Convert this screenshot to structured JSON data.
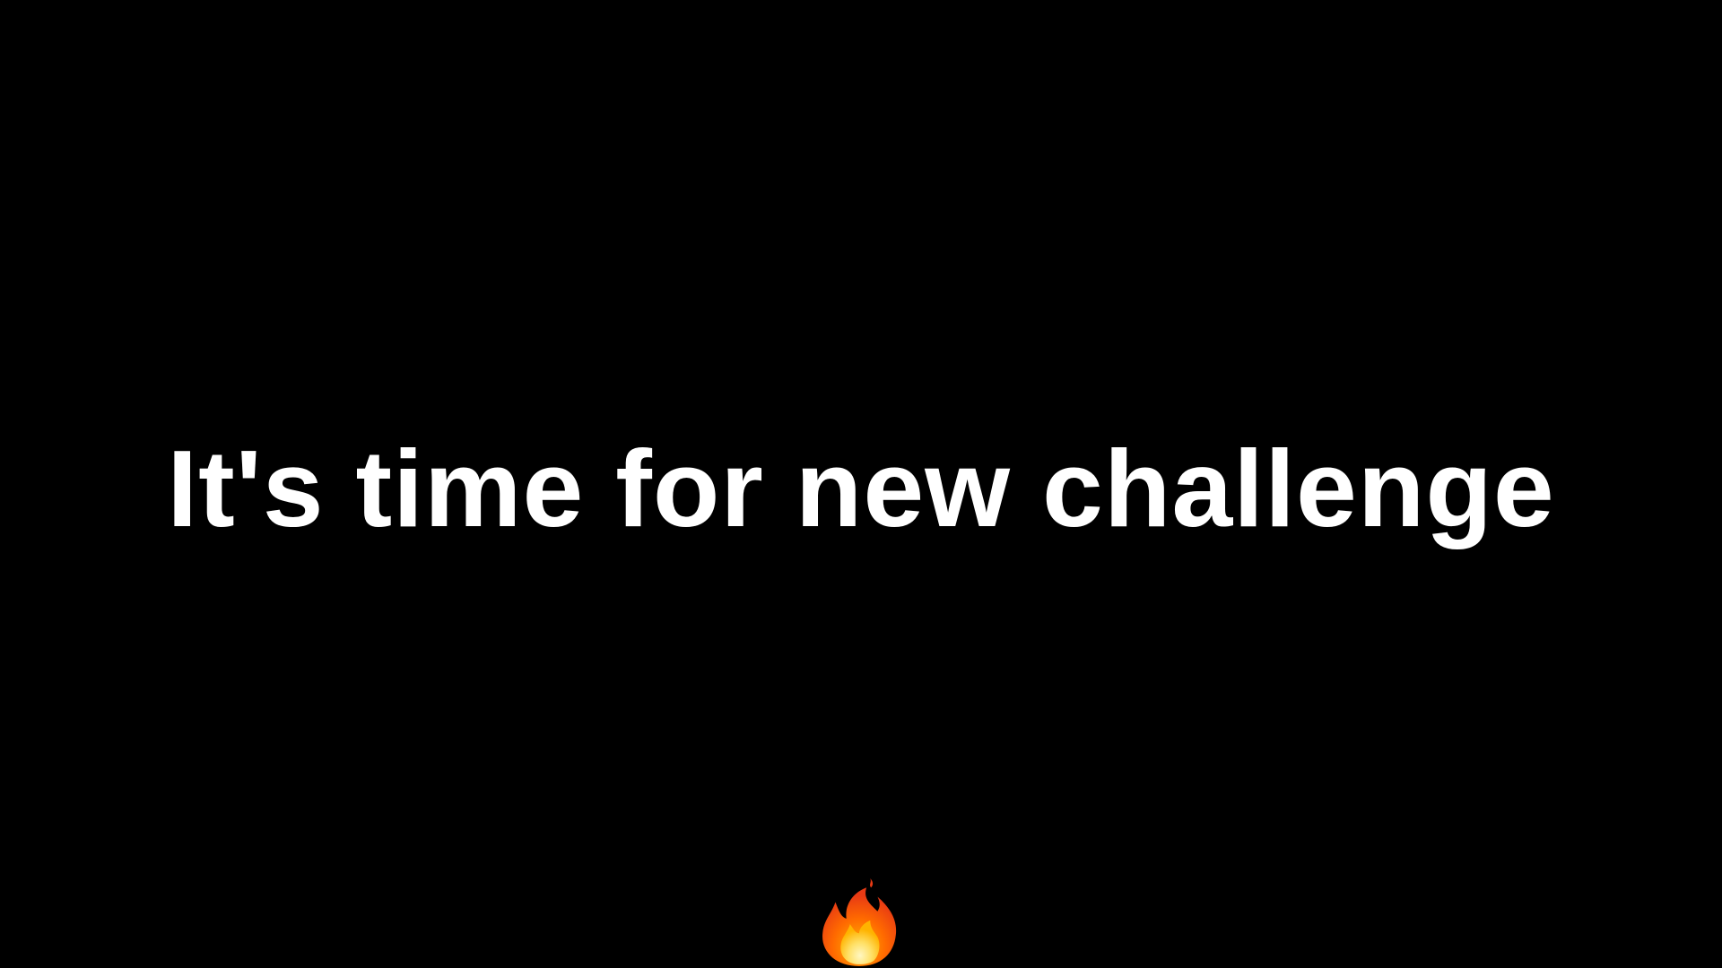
{
  "slide": {
    "headline": "It's time for new challenge",
    "background_color": "#000000",
    "text_color": "#ffffff",
    "icon": "fire-icon"
  }
}
